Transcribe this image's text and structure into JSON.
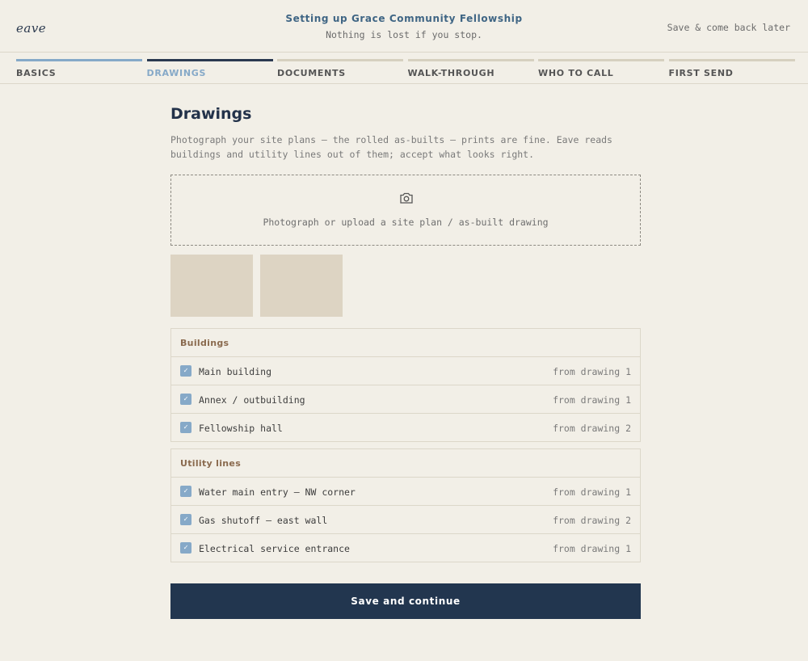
{
  "header": {
    "logo": "eave",
    "title": "Setting up Grace Community Fellowship",
    "subtitle": "Nothing is lost if you stop.",
    "save_later": "Save & come back later"
  },
  "steps": [
    {
      "label": "BASICS",
      "state": "done"
    },
    {
      "label": "DRAWINGS",
      "state": "active"
    },
    {
      "label": "DOCUMENTS",
      "state": "todo"
    },
    {
      "label": "WALK-THROUGH",
      "state": "todo"
    },
    {
      "label": "WHO TO CALL",
      "state": "todo"
    },
    {
      "label": "FIRST SEND",
      "state": "todo"
    }
  ],
  "page": {
    "title": "Drawings",
    "lead": "Photograph your site plans — the rolled as-builts — prints are fine. Eave reads buildings and utility lines out of them; accept what looks right.",
    "upload_label": "Photograph or upload a site plan / as-built drawing",
    "upload_icon": "camera-icon"
  },
  "buildings": {
    "heading": "Buildings",
    "items": [
      {
        "label": "Main building",
        "source": "from drawing 1",
        "checked": true
      },
      {
        "label": "Annex / outbuilding",
        "source": "from drawing 1",
        "checked": true
      },
      {
        "label": "Fellowship hall",
        "source": "from drawing 2",
        "checked": true
      }
    ]
  },
  "utilities": {
    "heading": "Utility lines",
    "items": [
      {
        "label": "Water main entry — NW corner",
        "source": "from drawing 1",
        "checked": true
      },
      {
        "label": "Gas shutoff — east wall",
        "source": "from drawing 2",
        "checked": true
      },
      {
        "label": "Electrical service entrance",
        "source": "from drawing 1",
        "checked": true
      }
    ]
  },
  "cta": "Save and continue",
  "colors": {
    "accent": "#86a9c8",
    "navy": "#22364f",
    "background": "#f2efe7",
    "heading_brown": "#8a6a4e"
  }
}
